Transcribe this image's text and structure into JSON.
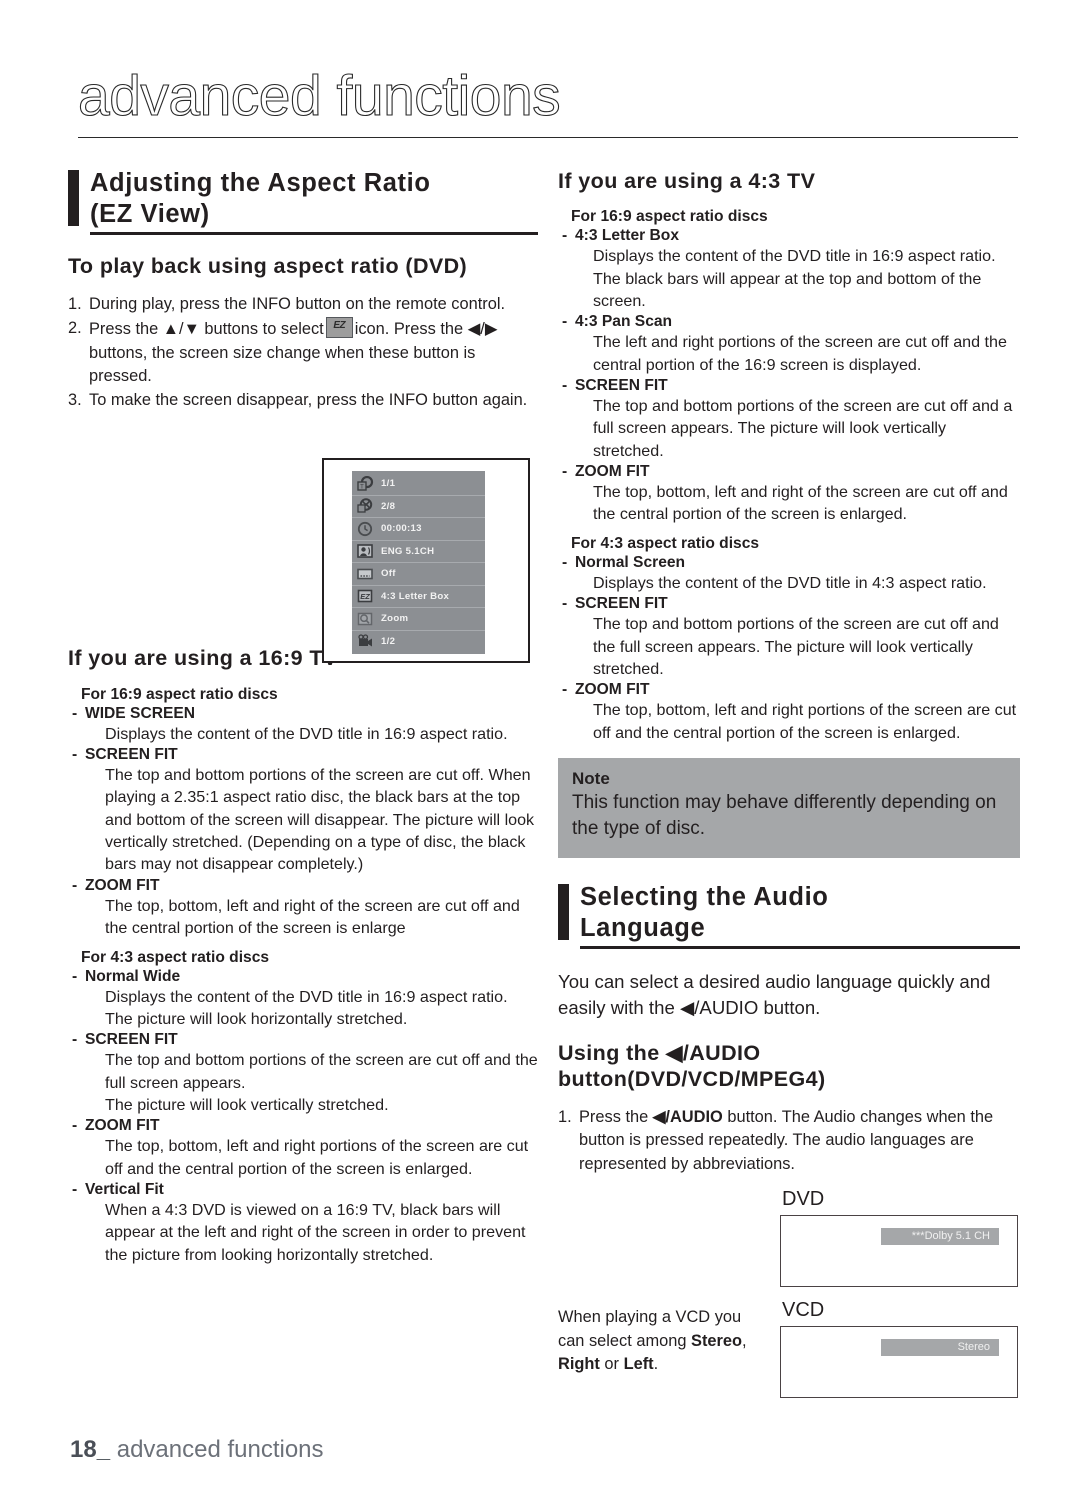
{
  "page": {
    "title": "advanced functions",
    "footer_number": "18_",
    "footer_text": "advanced functions"
  },
  "left": {
    "section": {
      "heading_line1": "Adjusting the Aspect Ratio",
      "heading_line2": "(EZ View)"
    },
    "subheading": "To play back using aspect ratio (DVD)",
    "steps": [
      {
        "num": "1.",
        "text": "During play, press the INFO  button on the remote control."
      },
      {
        "num": "2.",
        "part1": "Press the ▲/▼ buttons to select",
        "icon": "ez-view-icon",
        "icon_label": "EZ",
        "part2": "icon.  Press the ◀/▶ buttons, the screen size change when these button is pressed."
      },
      {
        "num": "3.",
        "text": "To make the screen disappear, press the INFO button again."
      }
    ],
    "osd": {
      "rows": [
        {
          "icon": "title-disc-icon",
          "value": "1/1"
        },
        {
          "icon": "chapter-icon",
          "value": "2/8"
        },
        {
          "icon": "clock-icon",
          "value": "00:00:13"
        },
        {
          "icon": "audio-icon",
          "value": "ENG 5.1CH"
        },
        {
          "icon": "subtitle-icon",
          "value": "Off"
        },
        {
          "icon": "ez-view-icon",
          "value": "4:3 Letter Box"
        },
        {
          "icon": "zoom-icon",
          "value": "Zoom"
        },
        {
          "icon": "angle-camera-icon",
          "value": "1/2"
        }
      ]
    },
    "tv_heading": "If you are using a 16:9 TV",
    "groups": [
      {
        "title": "For 16:9 aspect ratio discs",
        "items": [
          {
            "term": "WIDE SCREEN",
            "desc": "Displays the content of the DVD title in 16:9 aspect ratio."
          },
          {
            "term": "SCREEN FIT",
            "desc": "The top and bottom portions of the screen are cut off. When playing a 2.35:1 aspect ratio disc, the black bars at the top and bottom of the screen will disappear. The picture will look vertically stretched. (Depending on a type of disc, the black bars may not disappear completely.)"
          },
          {
            "term": "ZOOM FIT",
            "desc": "The top, bottom, left and right of the screen are cut off and the central portion of the screen is enlarge"
          }
        ]
      },
      {
        "title": "For 4:3 aspect ratio discs",
        "items": [
          {
            "term": "Normal Wide",
            "desc": "Displays the content of the DVD title in 16:9 aspect ratio. The picture will look horizontally stretched."
          },
          {
            "term": "SCREEN FIT",
            "desc": "The top and bottom portions of the screen are cut off and the full screen appears.\nThe picture will look vertically stretched."
          },
          {
            "term": "ZOOM FIT",
            "desc": "The top, bottom, left and right portions of the screen are cut off and the central portion of the screen is enlarged."
          },
          {
            "term": "Vertical Fit",
            "desc": "When a 4:3 DVD is viewed on a 16:9 TV, black bars will appear at the left and right of the screen in order to prevent the picture from looking horizontally stretched."
          }
        ]
      }
    ]
  },
  "right": {
    "tv_heading": "If you are using a 4:3 TV",
    "groups": [
      {
        "title": "For 16:9 aspect ratio discs",
        "items": [
          {
            "term": "4:3 Letter Box",
            "desc": "Displays the content of the DVD title in 16:9 aspect ratio. The  black bars will appear at the top and bottom of the screen."
          },
          {
            "term": "4:3 Pan Scan",
            "desc": "The left and right portions of the screen are cut off and the central portion of the 16:9 screen is displayed."
          },
          {
            "term": "SCREEN FIT",
            "desc": "The top and bottom portions of the screen are cut off and a full screen appears. The picture will look vertically stretched."
          },
          {
            "term": "ZOOM FIT",
            "desc": "The top, bottom, left and right of the screen are cut off and the central portion of the screen is enlarged."
          }
        ]
      },
      {
        "title": "For 4:3 aspect ratio discs",
        "items": [
          {
            "term": "Normal Screen",
            "desc": "Displays the content of the DVD title in 4:3 aspect ratio."
          },
          {
            "term": "SCREEN FIT",
            "desc": "The top and bottom portions of the screen are cut off and the  full screen appears. The picture will look vertically stretched."
          },
          {
            "term": "ZOOM FIT",
            "desc": "The top, bottom, left and right portions of the screen are cut off and the central portion of the screen is enlarged."
          }
        ]
      }
    ],
    "note": {
      "label": "Note",
      "body": "This function may behave differently depending on the type of disc."
    },
    "audio_section": {
      "heading_line1": "Selecting the Audio",
      "heading_line2": "Language",
      "intro": "You can select a desired audio language quickly and easily with the ◀/AUDIO button.",
      "subheading": "Using the ◀/AUDIO button(DVD/VCD/MPEG4)",
      "step_num": "1.",
      "step_pre": "Press the ",
      "step_bold": "◀/AUDIO",
      "step_post": " button. The Audio changes when the button is pressed repeatedly. The audio languages are  represented by abbreviations.",
      "dvd_label": "DVD",
      "dvd_chip": "***Dolby 5.1 CH",
      "vcd_label": "VCD",
      "vcd_chip": "Stereo",
      "vcd_note_pre": "When playing a VCD you can select among ",
      "vcd_note_b1": "Stereo",
      "vcd_note_mid": ", ",
      "vcd_note_b2": "Right",
      "vcd_note_mid2": " or ",
      "vcd_note_b3": "Left",
      "vcd_note_end": "."
    }
  },
  "colors": {
    "ink": "#231f20",
    "note_bg": "#a5a7a9",
    "osd_bg": "#8c8f93",
    "footer": "#6c7179"
  }
}
